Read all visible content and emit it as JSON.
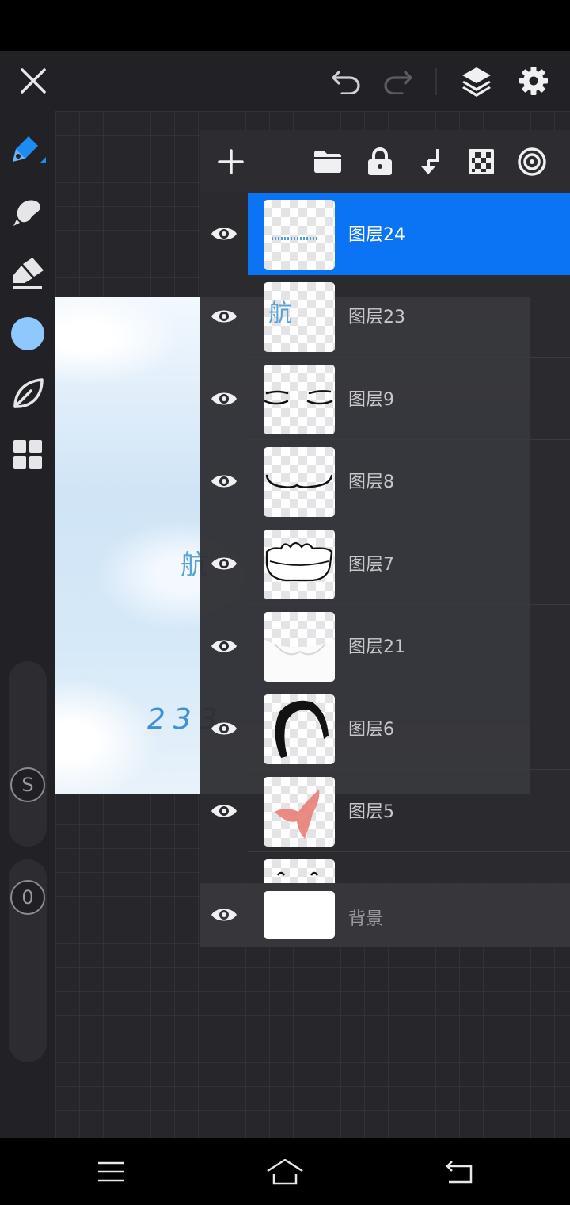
{
  "top_bar": {
    "close_icon": "close-icon",
    "undo_icon": "undo-icon",
    "redo_icon": "redo-icon",
    "layers_icon": "layers-icon",
    "settings_icon": "gear-icon"
  },
  "tools": [
    {
      "name": "brush",
      "icon": "pen-icon"
    },
    {
      "name": "smudge",
      "icon": "smudge-icon"
    },
    {
      "name": "eraser",
      "icon": "eraser-icon"
    },
    {
      "name": "color",
      "icon": "color-swatch",
      "color": "#8ec8ff"
    },
    {
      "name": "leaf",
      "icon": "leaf-icon"
    },
    {
      "name": "materials",
      "icon": "grid-icon"
    }
  ],
  "size_slider": {
    "label": "S"
  },
  "opacity_slider": {
    "label": "0"
  },
  "canvas": {
    "text_1": "航",
    "text_2": "233"
  },
  "layers_panel": {
    "header_icons": [
      "add-icon",
      "folder-icon",
      "lock-icon",
      "merge-down-icon",
      "transparency-icon",
      "blend-icon"
    ],
    "layers": [
      {
        "name": "图层24",
        "selected": true
      },
      {
        "name": "图层23",
        "selected": false
      },
      {
        "name": "图层9",
        "selected": false
      },
      {
        "name": "图层8",
        "selected": false
      },
      {
        "name": "图层7",
        "selected": false
      },
      {
        "name": "图层21",
        "selected": false
      },
      {
        "name": "图层6",
        "selected": false
      },
      {
        "name": "图层5",
        "selected": false
      }
    ],
    "thumb_23_text": "航",
    "background_layer": "背景"
  },
  "colors": {
    "accent": "#0a74f5",
    "panel": "#2c2c30",
    "brush_color": "#8ec8ff"
  }
}
